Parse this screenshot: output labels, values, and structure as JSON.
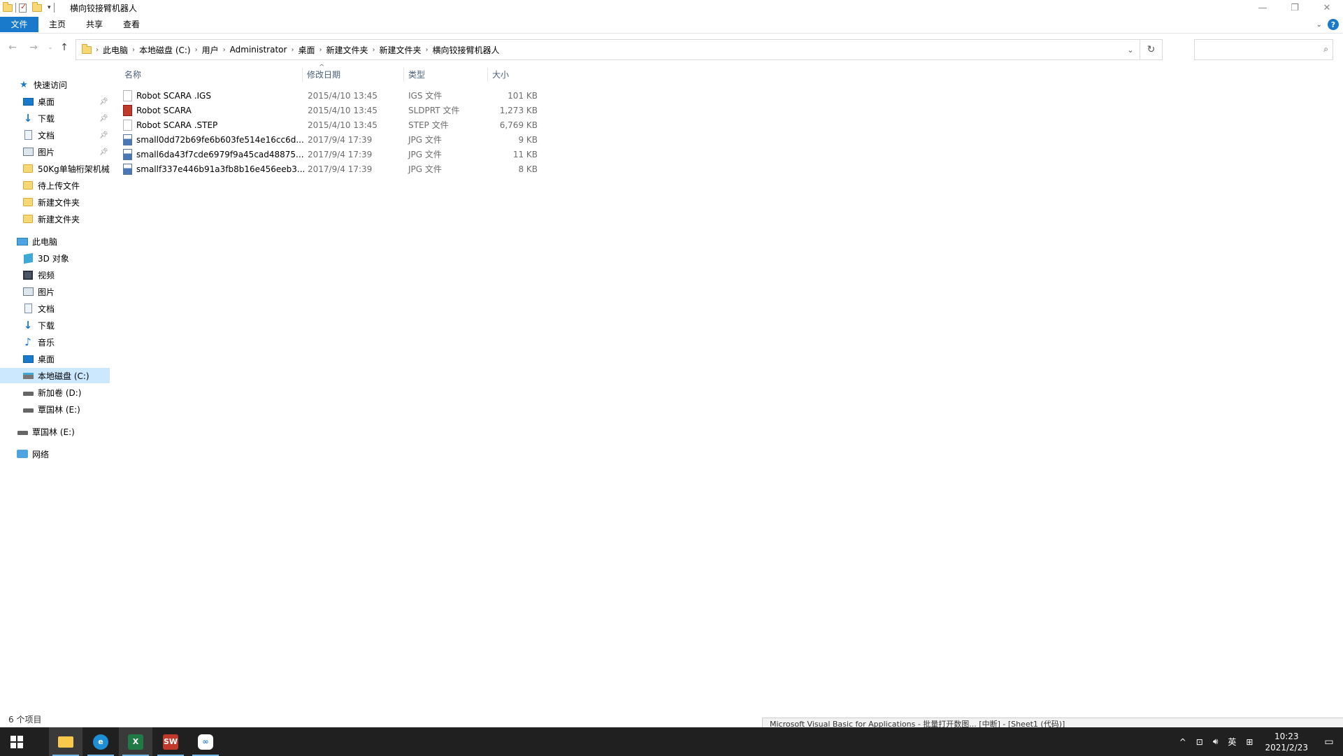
{
  "window": {
    "title": "横向铰接臂机器人",
    "controls": {
      "minimize": "—",
      "maximize": "❐",
      "close": "✕"
    }
  },
  "ribbon": {
    "tabs": [
      "文件",
      "主页",
      "共享",
      "查看"
    ],
    "help": "?"
  },
  "address": {
    "crumbs": [
      "此电脑",
      "本地磁盘 (C:)",
      "用户",
      "Administrator",
      "桌面",
      "新建文件夹",
      "新建文件夹",
      "横向铰接臂机器人"
    ],
    "search_placeholder": ""
  },
  "sidebar": {
    "quick_access": "快速访问",
    "quick_items": [
      "桌面",
      "下载",
      "文档",
      "图片",
      "50Kg单轴桁架机械",
      "待上传文件",
      "新建文件夹",
      "新建文件夹"
    ],
    "this_pc": "此电脑",
    "pc_items": [
      "3D 对象",
      "视频",
      "图片",
      "文档",
      "下载",
      "音乐",
      "桌面",
      "本地磁盘 (C:)",
      "新加卷 (D:)",
      "覃国林 (E:)"
    ],
    "drive_e": "覃国林 (E:)",
    "network": "网络"
  },
  "columns": {
    "name": "名称",
    "date": "修改日期",
    "type": "类型",
    "size": "大小"
  },
  "files": [
    {
      "name": "Robot SCARA .IGS",
      "date": "2015/4/10 13:45",
      "type": "IGS 文件",
      "size": "101 KB",
      "icon": "generic-file-icon"
    },
    {
      "name": "Robot SCARA",
      "date": "2015/4/10 13:45",
      "type": "SLDPRT 文件",
      "size": "1,273 KB",
      "icon": "solidworks-part-icon"
    },
    {
      "name": "Robot SCARA .STEP",
      "date": "2015/4/10 13:45",
      "type": "STEP 文件",
      "size": "6,769 KB",
      "icon": "generic-file-icon"
    },
    {
      "name": "small0dd72b69fe6b603fe514e16cc6d...",
      "date": "2017/9/4 17:39",
      "type": "JPG 文件",
      "size": "9 KB",
      "icon": "jpg-file-icon"
    },
    {
      "name": "small6da43f7cde6979f9a45cad48875...",
      "date": "2017/9/4 17:39",
      "type": "JPG 文件",
      "size": "11 KB",
      "icon": "jpg-file-icon"
    },
    {
      "name": "smallf337e446b91a3fb8b16e456eeb3...",
      "date": "2017/9/4 17:39",
      "type": "JPG 文件",
      "size": "8 KB",
      "icon": "jpg-file-icon"
    }
  ],
  "status": {
    "count": "6 个项目"
  },
  "background_window_text": "Microsoft Visual Basic for Applications - 批量打开数图... [中断] - [Sheet1 (代码)]",
  "taskbar": {
    "apps": [
      "file-explorer",
      "edge-browser",
      "excel",
      "solidworks",
      "baidu-netdisk"
    ],
    "tray": {
      "ime": "英",
      "time": "10:23",
      "date": "2021/2/23"
    }
  },
  "colors": {
    "accent": "#1979ca",
    "selected": "#cce8ff",
    "taskbar": "#202020"
  }
}
